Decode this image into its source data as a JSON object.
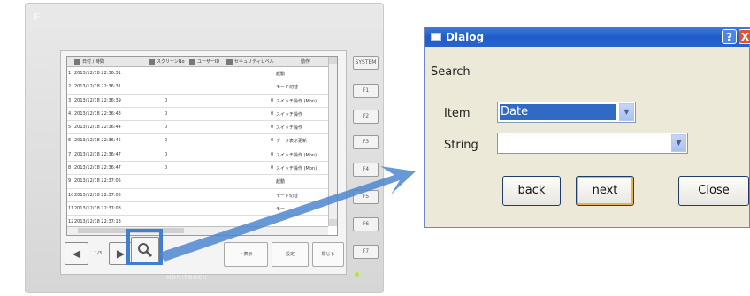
{
  "device": {
    "brand_glyph": "F",
    "maker": "MONITOUCH",
    "grid": {
      "columns": [
        "日付 / 時間",
        "スクリーンNo",
        "ユーザーID",
        "セキュリティレベル",
        "動作"
      ],
      "rows": [
        {
          "no": "1",
          "datetime": "2013/12/18 22:36:31",
          "screen": "",
          "level": "",
          "action": "起動"
        },
        {
          "no": "2",
          "datetime": "2013/12/18 22:36:31",
          "screen": "",
          "level": "",
          "action": "モード切替"
        },
        {
          "no": "3",
          "datetime": "2013/12/18 22:36:39",
          "screen": "0",
          "level": "0",
          "action": "スイッチ操作 (Mon)"
        },
        {
          "no": "4",
          "datetime": "2013/12/18 22:36:43",
          "screen": "0",
          "level": "0",
          "action": "スイッチ操作"
        },
        {
          "no": "5",
          "datetime": "2013/12/18 22:36:44",
          "screen": "0",
          "level": "0",
          "action": "スイッチ操作"
        },
        {
          "no": "6",
          "datetime": "2013/12/18 22:36:45",
          "screen": "0",
          "level": "0",
          "action": "データ表示更新"
        },
        {
          "no": "7",
          "datetime": "2013/12/18 22:36:47",
          "screen": "0",
          "level": "0",
          "action": "スイッチ操作 (Mon)"
        },
        {
          "no": "8",
          "datetime": "2013/12/18 22:36:47",
          "screen": "0",
          "level": "0",
          "action": "スイッチ操作 (Mon)"
        },
        {
          "no": "9",
          "datetime": "2013/12/18 22:37:05",
          "screen": "",
          "level": "",
          "action": "起動"
        },
        {
          "no": "10",
          "datetime": "2013/12/18 22:37:05",
          "screen": "",
          "level": "",
          "action": "モード切替"
        },
        {
          "no": "11",
          "datetime": "2013/12/18 22:37:08",
          "screen": "",
          "level": "",
          "action": "モー"
        },
        {
          "no": "12",
          "datetime": "2013/12/18 22:37:13",
          "screen": "",
          "level": "",
          "action": ""
        }
      ]
    },
    "page_info": "1/3",
    "soft_buttons": [
      "ト表示",
      "設定",
      "閉じる"
    ],
    "fkeys": [
      "SYSTEM",
      "F1",
      "F2",
      "F3",
      "F4",
      "F5",
      "F6",
      "F7"
    ],
    "highlight_color": "#3f7ed1",
    "icons": {
      "prev": "prev-page-icon",
      "next": "next-page-icon",
      "search": "magnifier-icon"
    }
  },
  "dialog": {
    "title": "Dialog",
    "help_glyph": "?",
    "close_glyph": "X",
    "heading": "Search",
    "item_label": "Item",
    "item_value": "Date",
    "string_label": "String",
    "string_value": "",
    "buttons": {
      "back": "back",
      "next": "next",
      "close": "Close"
    },
    "titlebar_color": "#2962cd",
    "selection_color": "#316ac5"
  }
}
